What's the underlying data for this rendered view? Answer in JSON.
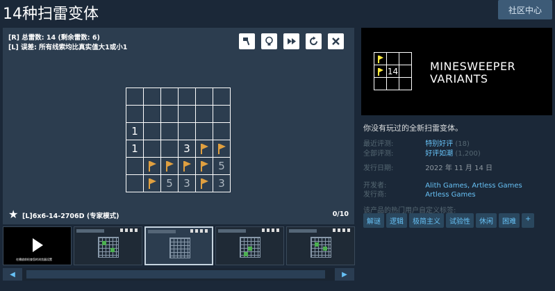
{
  "header": {
    "title": "14种扫雷变体",
    "community_button": "社区中心"
  },
  "game": {
    "info_line1": "[R] 总雷数: 14 (剩余雷数: 6)",
    "info_line2": "[L] 误差: 所有线索均比真实值大1或小1",
    "puzzle_code": "[L]6x6-14-2706D (专家模式)",
    "progress": "0/10",
    "tools": [
      "paint-icon",
      "lightbulb-icon",
      "fast-forward-icon",
      "restart-icon",
      "close-icon"
    ],
    "board": [
      [
        "",
        "",
        "",
        "",
        "",
        ""
      ],
      [
        "",
        "",
        "",
        "",
        "",
        ""
      ],
      [
        "1",
        "",
        "",
        "",
        "",
        ""
      ],
      [
        "1",
        "",
        "",
        "3",
        "F",
        "F"
      ],
      [
        "",
        "F",
        "F",
        "F",
        "F",
        "5"
      ],
      [
        "",
        "F",
        "5",
        "3",
        "F",
        "3"
      ]
    ]
  },
  "thumbnails": {
    "count": 5,
    "active_index": 2,
    "first_caption": "在播放前检查您的浏览器设置",
    "scroll_left": "◀",
    "scroll_right": "▶"
  },
  "capsule": {
    "logo_line1": "MINESWEEPER",
    "logo_line2": "VARIANTS",
    "logo_number": "14"
  },
  "details": {
    "description": "你没有玩过的全新扫雷变体。",
    "recent_reviews_label": "最近评测:",
    "recent_reviews_value": "特别好评",
    "recent_reviews_count": "(18)",
    "all_reviews_label": "全部评测:",
    "all_reviews_value": "好评如潮",
    "all_reviews_count": "(1,200)",
    "release_label": "发行日期:",
    "release_value": "2022 年 11 月 14 日",
    "developer_label": "开发者:",
    "developer_value": "Alith Games, Artless Games",
    "publisher_label": "发行商:",
    "publisher_value": "Artless Games",
    "tags_label": "该产品的热门用户自定义标签:",
    "tags": [
      "解谜",
      "逻辑",
      "极简主义",
      "试验性",
      "休闲",
      "困难",
      "+"
    ]
  },
  "colors": {
    "background": "#1b2838",
    "accent_link": "#67c1f5",
    "flag_orange": "#e0a040",
    "logo_flag_yellow": "#ffe93d"
  }
}
